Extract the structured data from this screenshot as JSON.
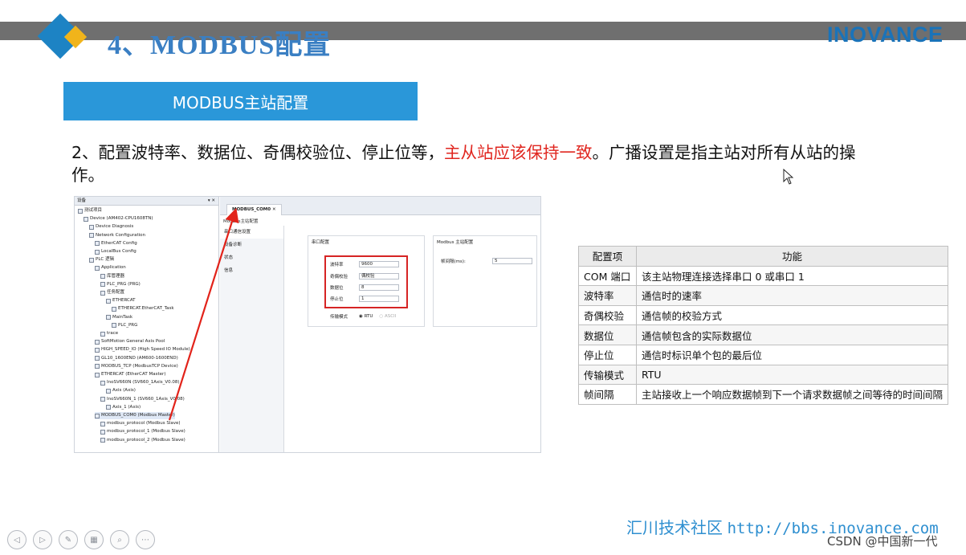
{
  "header": {
    "title": "4、MODBUS配置",
    "brand": "INOVANCE"
  },
  "banner": {
    "label": "MODBUS主站配置"
  },
  "description": {
    "part1": "2、配置波特率、数据位、奇偶校验位、停止位等，",
    "highlight": "主从站应该保持一致",
    "part2": "。广播设置是指主站对所有从站的操作。"
  },
  "ide": {
    "left_header": "设备",
    "tree": [
      "测试项目",
      "Device (AM402-CPU1608TN)",
      "Device Diagnosis",
      "Network Configuration",
      "EtherCAT Config",
      "LocalBus Config",
      "PLC 逻辑",
      "Application",
      "库管理器",
      "PLC_PRG (PRG)",
      "任务配置",
      "ETHERCAT",
      "ETHERCAT.EtherCAT_Task",
      "MainTask",
      "PLC_PRG",
      "trace",
      "SoftMotion General Axis Pool",
      "HIGH_SPEED_IO (High Speed IO Module)",
      "GL10_1600END (AM600-1600END)",
      "MODBUS_TCP (ModbusTCP Device)",
      "ETHERCAT (EtherCAT Master)",
      "InoSV660N (SV660_1Axis_V0.08)",
      "Axis (Axis)",
      "InoSV660N_1 (SV660_1Axis_V0.08)",
      "Axis_1 (Axis)",
      "MODBUS_COM0 (Modbus Master)",
      "modbus_protocol (Modbus Slave)",
      "modbus_protocol_1 (Modbus Slave)",
      "modbus_protocol_2 (Modbus Slave)"
    ],
    "tab": "MODBUS_COM0",
    "subtab": "Modbus主站配置",
    "nav": [
      "串口通信设置",
      "设备诊断",
      "状态",
      "信息"
    ],
    "serial_group": "串口配置",
    "fields": [
      {
        "label": "波特率",
        "value": "9600"
      },
      {
        "label": "奇偶校验",
        "value": "偶校验"
      },
      {
        "label": "数据位",
        "value": "8"
      },
      {
        "label": "停止位",
        "value": "1"
      }
    ],
    "transfer_label": "传输模式",
    "rtu": "RTU",
    "ascii": "ASCII",
    "master_group": "Modbus 主站配置",
    "interval_label": "帧间隔(ms):",
    "interval_value": "5"
  },
  "table": {
    "headers": [
      "配置项",
      "功能"
    ],
    "rows": [
      [
        "COM 端口",
        "该主站物理连接选择串口 0 或串口 1"
      ],
      [
        "波特率",
        "通信时的速率"
      ],
      [
        "奇偶校验",
        "通信帧的校验方式"
      ],
      [
        "数据位",
        "通信帧包含的实际数据位"
      ],
      [
        "停止位",
        "通信时标识单个包的最后位"
      ],
      [
        "传输模式",
        "RTU"
      ],
      [
        "帧间隔",
        "主站接收上一个响应数据帧到下一个请求数据帧之间等待的时间间隔"
      ]
    ]
  },
  "footer": {
    "community": "汇川技术社区",
    "url": "http://bbs.inovance.com",
    "watermark": "CSDN @中国新一代"
  },
  "colors": {
    "title_blue": "#3a7fc3",
    "banner_blue": "#2a97d9",
    "highlight_red": "#e0261f",
    "brand_blue": "#1a73b9"
  },
  "player_controls": [
    "prev-icon",
    "next-icon",
    "pen-icon",
    "slides-icon",
    "zoom-icon",
    "more-icon"
  ]
}
